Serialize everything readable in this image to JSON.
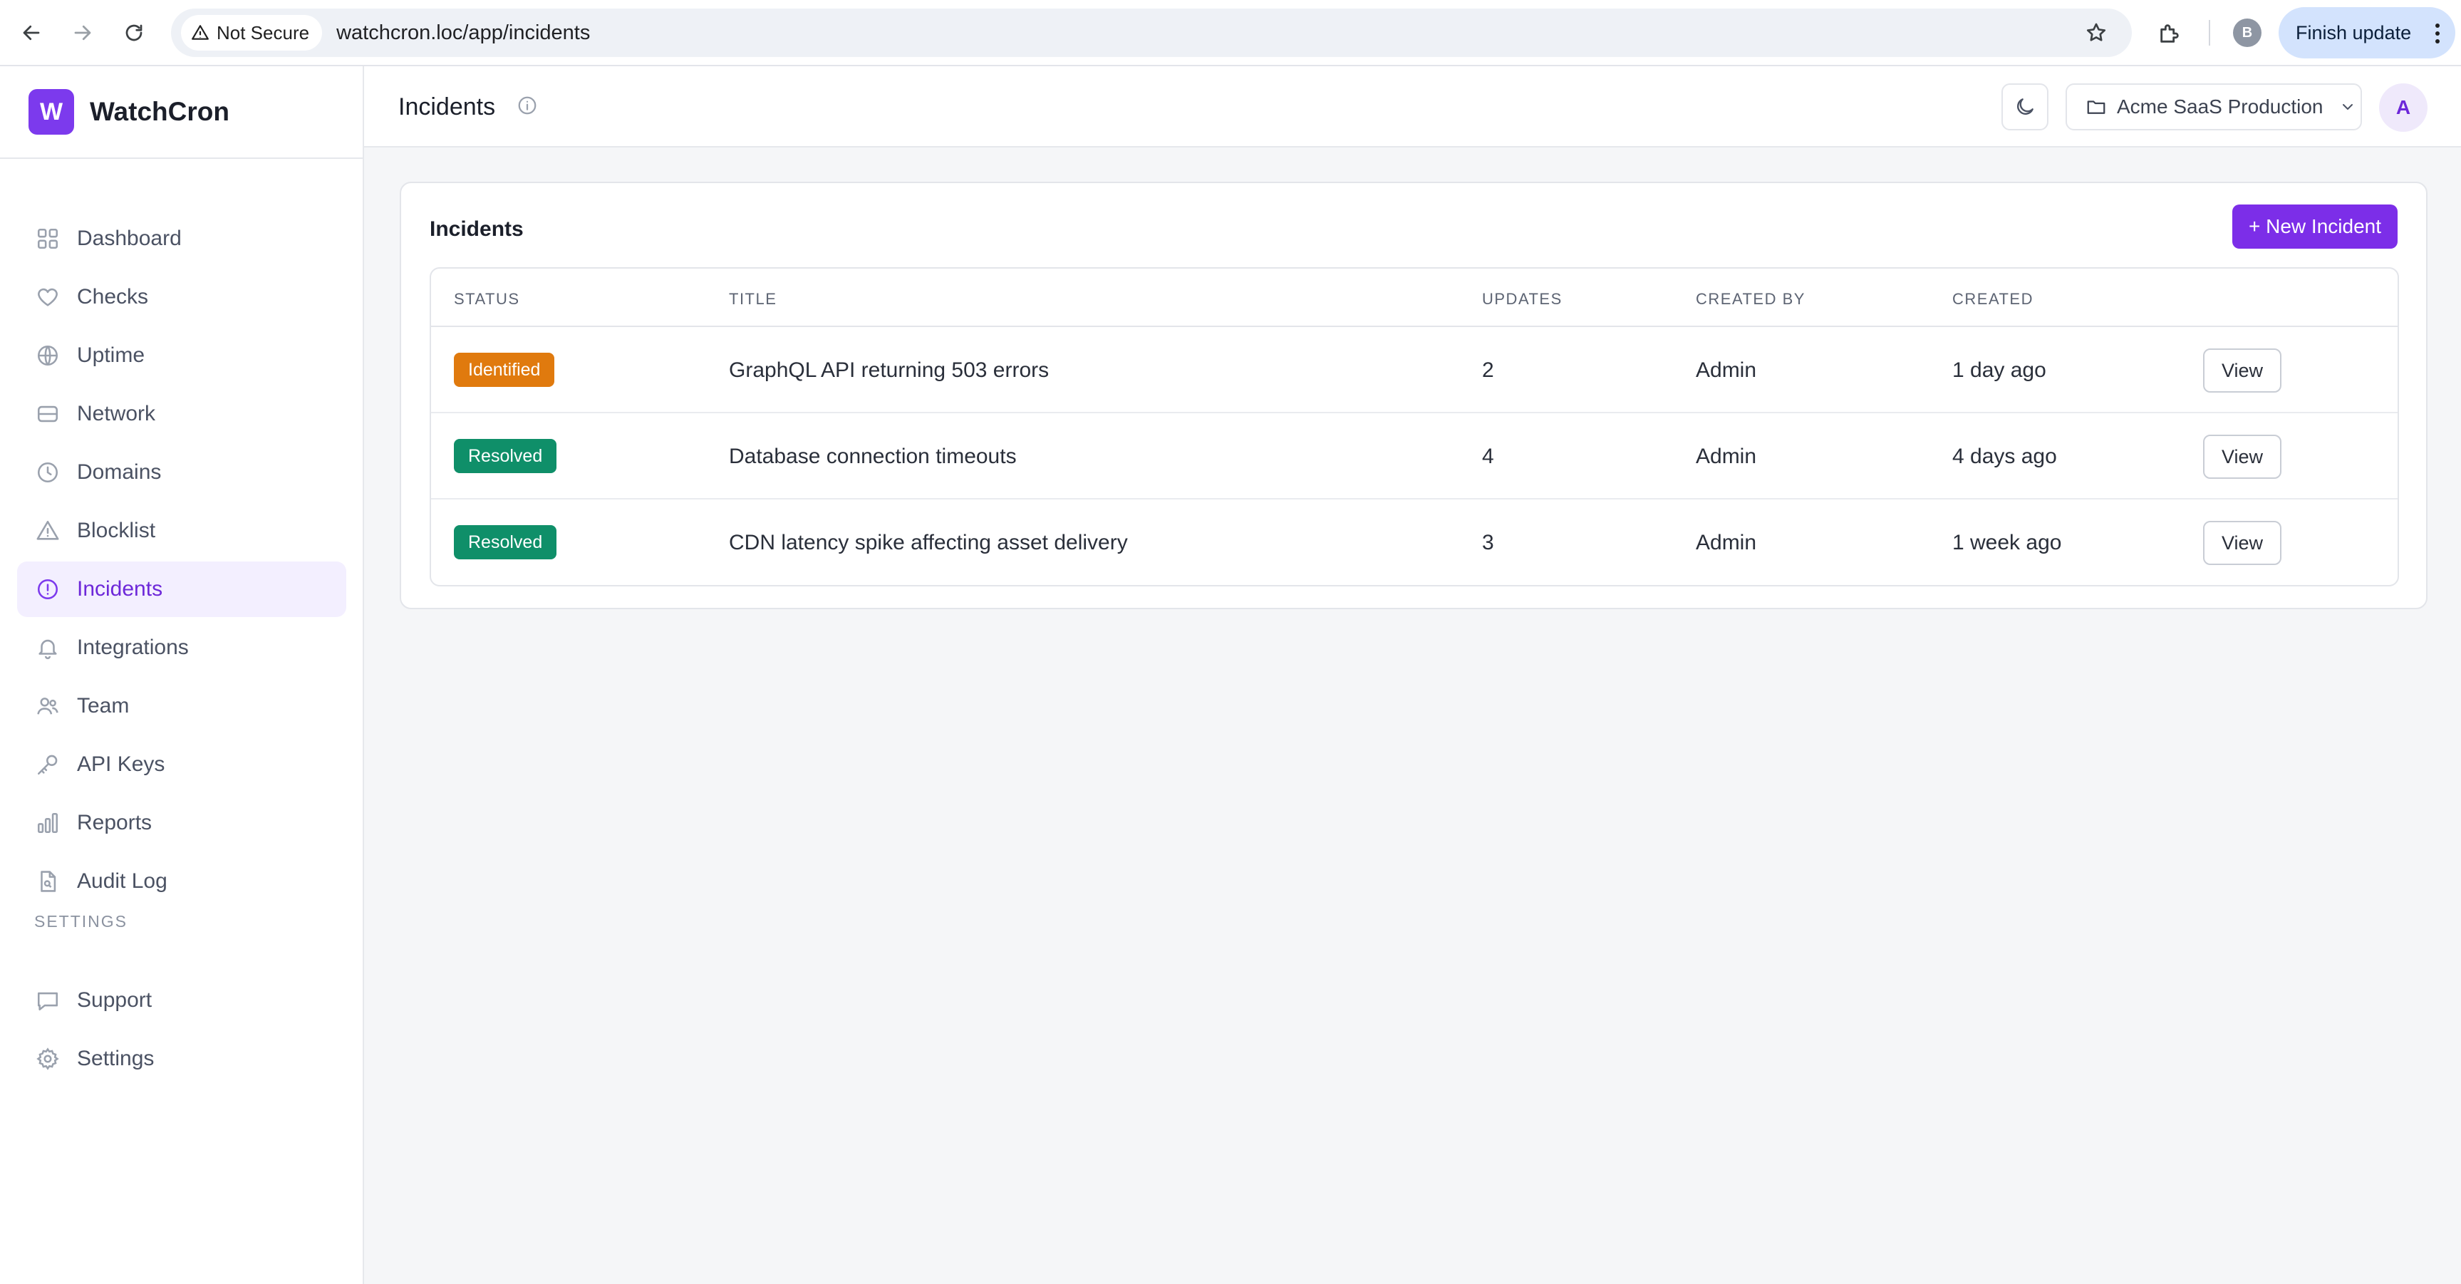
{
  "browser": {
    "security_label": "Not Secure",
    "url": "watchcron.loc/app/incidents",
    "profile_initial": "B",
    "update_label": "Finish update"
  },
  "brand": {
    "logo_letter": "W",
    "name": "WatchCron",
    "accent_color": "#7c3aed"
  },
  "sidebar": {
    "items": [
      {
        "label": "Dashboard",
        "icon": "dashboard-grid-icon"
      },
      {
        "label": "Checks",
        "icon": "heart-icon"
      },
      {
        "label": "Uptime",
        "icon": "globe-icon"
      },
      {
        "label": "Network",
        "icon": "server-icon"
      },
      {
        "label": "Domains",
        "icon": "clock-icon"
      },
      {
        "label": "Blocklist",
        "icon": "warning-icon"
      },
      {
        "label": "Incidents",
        "icon": "alert-circle-icon",
        "active": true
      },
      {
        "label": "Integrations",
        "icon": "bell-icon"
      },
      {
        "label": "Team",
        "icon": "users-icon"
      },
      {
        "label": "API Keys",
        "icon": "key-icon"
      },
      {
        "label": "Reports",
        "icon": "bar-chart-icon"
      },
      {
        "label": "Audit Log",
        "icon": "file-search-icon"
      }
    ],
    "settings_section_label": "SETTINGS",
    "settings_items": [
      {
        "label": "Support",
        "icon": "chat-icon"
      },
      {
        "label": "Settings",
        "icon": "gear-icon"
      }
    ]
  },
  "topbar": {
    "title": "Incidents",
    "project": "Acme SaaS Production",
    "avatar_initial": "A"
  },
  "incidents": {
    "card_title": "Incidents",
    "new_button_label": "+ New Incident",
    "columns": [
      "STATUS",
      "TITLE",
      "UPDATES",
      "CREATED BY",
      "CREATED"
    ],
    "view_label": "View",
    "status_colors": {
      "Identified": "#e07a0e",
      "Resolved": "#0f8f69"
    },
    "rows": [
      {
        "status": "Identified",
        "title": "GraphQL API returning 503 errors",
        "updates": "2",
        "created_by": "Admin",
        "created": "1 day ago"
      },
      {
        "status": "Resolved",
        "title": "Database connection timeouts",
        "updates": "4",
        "created_by": "Admin",
        "created": "4 days ago"
      },
      {
        "status": "Resolved",
        "title": "CDN latency spike affecting asset delivery",
        "updates": "3",
        "created_by": "Admin",
        "created": "1 week ago"
      }
    ]
  }
}
